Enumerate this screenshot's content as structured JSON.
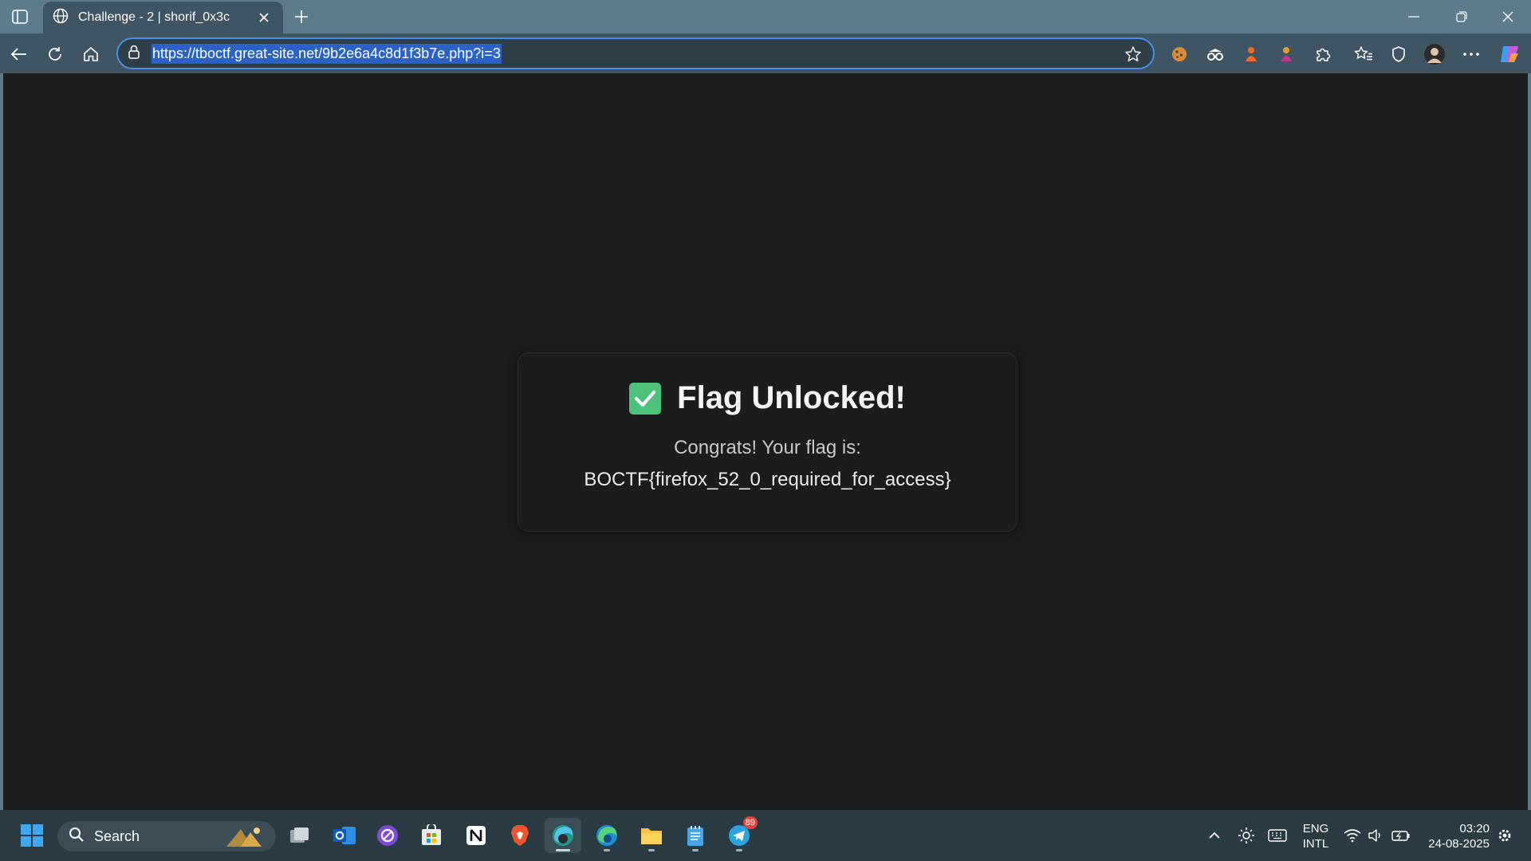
{
  "browser": {
    "tab_title": "Challenge - 2 | shorif_0x3c",
    "url": "https://tboctf.great-site.net/9b2e6a4c8d1f3b7e.php?i=3"
  },
  "page": {
    "heading": "Flag Unlocked!",
    "message": "Congrats! Your flag is:",
    "flag": "BOCTF{firefox_52_0_required_for_access}",
    "check_icon": "white-check-mark-emoji",
    "check_color": "#4cc17a"
  },
  "taskbar": {
    "search_label": "Search",
    "telegram_badge": "89",
    "language_line1": "ENG",
    "language_line2": "INTL",
    "time": "03:20",
    "date": "24-08-2025"
  },
  "theme": {
    "accent": "#4c8fe6",
    "page_background": "#1c1d1f",
    "chrome": "#3f5563"
  }
}
